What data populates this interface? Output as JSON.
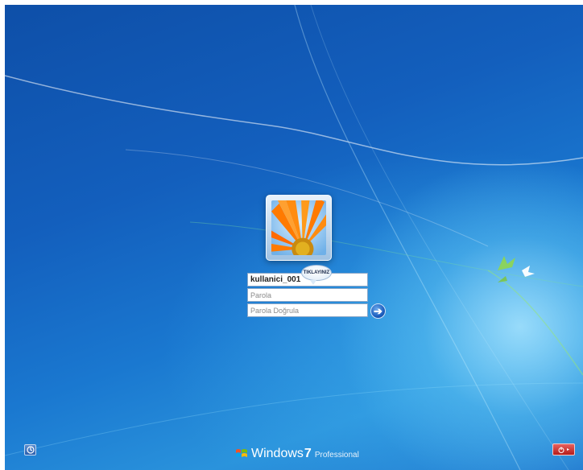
{
  "login": {
    "username": "kullanici_001",
    "tooltip": "TIKLAYINIZ",
    "password_placeholder": "Parola",
    "confirm_placeholder": "Parola Doğrula"
  },
  "branding": {
    "word": "Windows",
    "version": "7",
    "edition": "Professional"
  },
  "icons": {
    "submit": "arrow-right-icon",
    "ease_of_access": "ease-of-access-icon",
    "power": "power-icon",
    "menu": "chevron-right-icon",
    "logo": "windows-flag-icon",
    "birds": "birds-icon"
  },
  "colors": {
    "background": "#1a78d0",
    "power_button": "#c8312f",
    "submit_button": "#1d5fbf"
  }
}
